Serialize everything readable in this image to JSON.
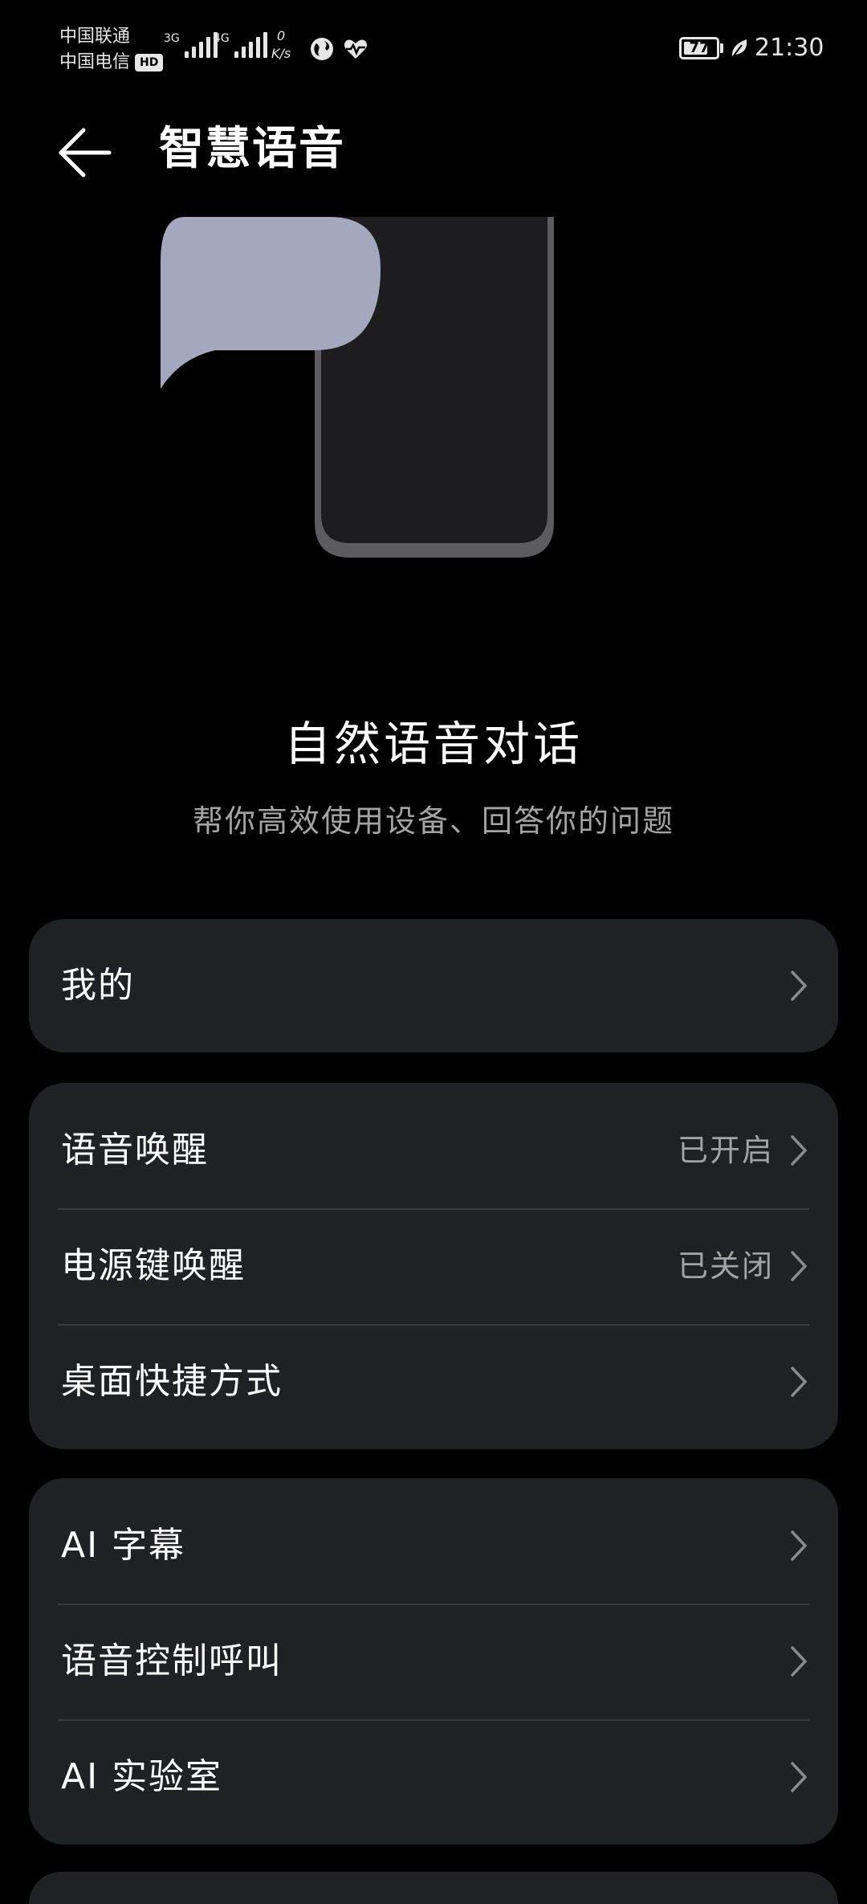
{
  "status_bar": {
    "carrier1": "中国联通",
    "carrier2": "中国电信",
    "hd_badge": "HD",
    "sim1_network": "3G",
    "sim2_network": "4G",
    "speed_value": "0",
    "speed_unit": "K/s",
    "battery_level": "77",
    "battery_fraction": 0.77,
    "time": "21:30",
    "icons": [
      "signal-icon",
      "globe-icon",
      "heart-rate-icon",
      "battery-icon",
      "leaf-icon"
    ]
  },
  "header": {
    "back_icon": "back-arrow-icon",
    "title": "智慧语音"
  },
  "hero": {
    "title": "自然语音对话",
    "subtitle": "帮你高效使用设备、回答你的问题"
  },
  "groups": [
    {
      "items": [
        {
          "label": "我的",
          "value": ""
        }
      ]
    },
    {
      "items": [
        {
          "label": "语音唤醒",
          "value": "已开启"
        },
        {
          "label": "电源键唤醒",
          "value": "已关闭"
        },
        {
          "label": "桌面快捷方式",
          "value": ""
        }
      ]
    },
    {
      "items": [
        {
          "label": "AI 字幕",
          "value": ""
        },
        {
          "label": "语音控制呼叫",
          "value": ""
        },
        {
          "label": "AI 实验室",
          "value": ""
        }
      ]
    }
  ],
  "colors": {
    "background": "#000000",
    "card": "#202124",
    "divider": "#3a3a3d",
    "secondary_text": "#a3a3a3",
    "bubble": "#a4a8bf",
    "phone_frame": "#5c5c60"
  }
}
